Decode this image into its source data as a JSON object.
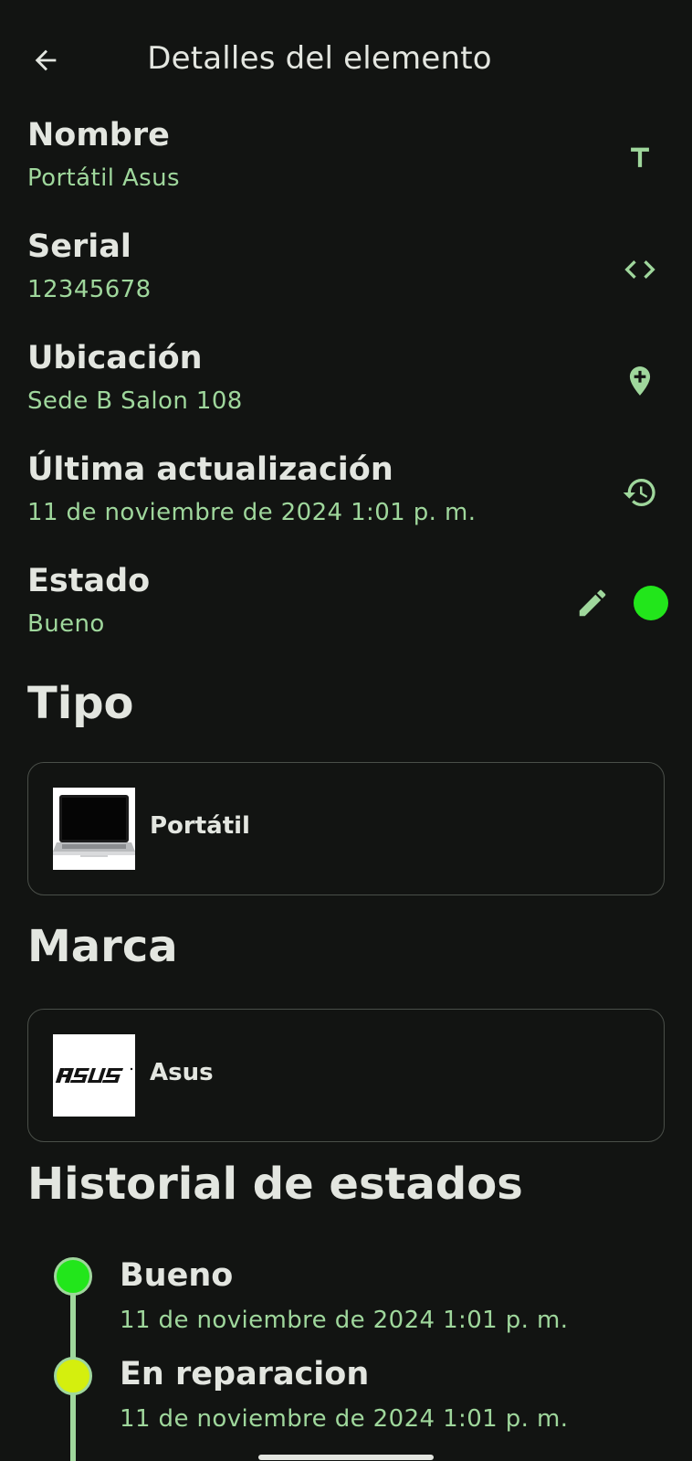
{
  "header": {
    "title": "Detalles del elemento"
  },
  "details": {
    "nombre": {
      "label": "Nombre",
      "value": "Portátil Asus",
      "icon": "text-icon"
    },
    "serial": {
      "label": "Serial",
      "value": "12345678",
      "icon": "code-icon"
    },
    "ubicacion": {
      "label": "Ubicación",
      "value": "Sede B Salon 108",
      "icon": "add-location-icon"
    },
    "actualizacion": {
      "label": "Última actualización",
      "value": "11 de noviembre de 2024 1:01 p. m.",
      "icon": "history-icon"
    },
    "estado": {
      "label": "Estado",
      "value": "Bueno",
      "icon": "edit-icon",
      "status_color": "#22e61b"
    }
  },
  "tipo": {
    "title": "Tipo",
    "label": "Portátil",
    "thumb": "laptop-image"
  },
  "marca": {
    "title": "Marca",
    "label": "Asus",
    "thumb": "asus-logo"
  },
  "historial": {
    "title": "Historial de estados",
    "items": [
      {
        "label": "Bueno",
        "date": "11 de noviembre de 2024 1:01 p. m.",
        "color": "#22e61b"
      },
      {
        "label": "En reparacion",
        "date": "11 de noviembre de 2024 1:01 p. m.",
        "color": "#d4ef0e"
      }
    ]
  },
  "colors": {
    "background": "#121412",
    "accent": "#9fd79c",
    "text": "#e3e6e0",
    "border": "#4a4f49"
  }
}
